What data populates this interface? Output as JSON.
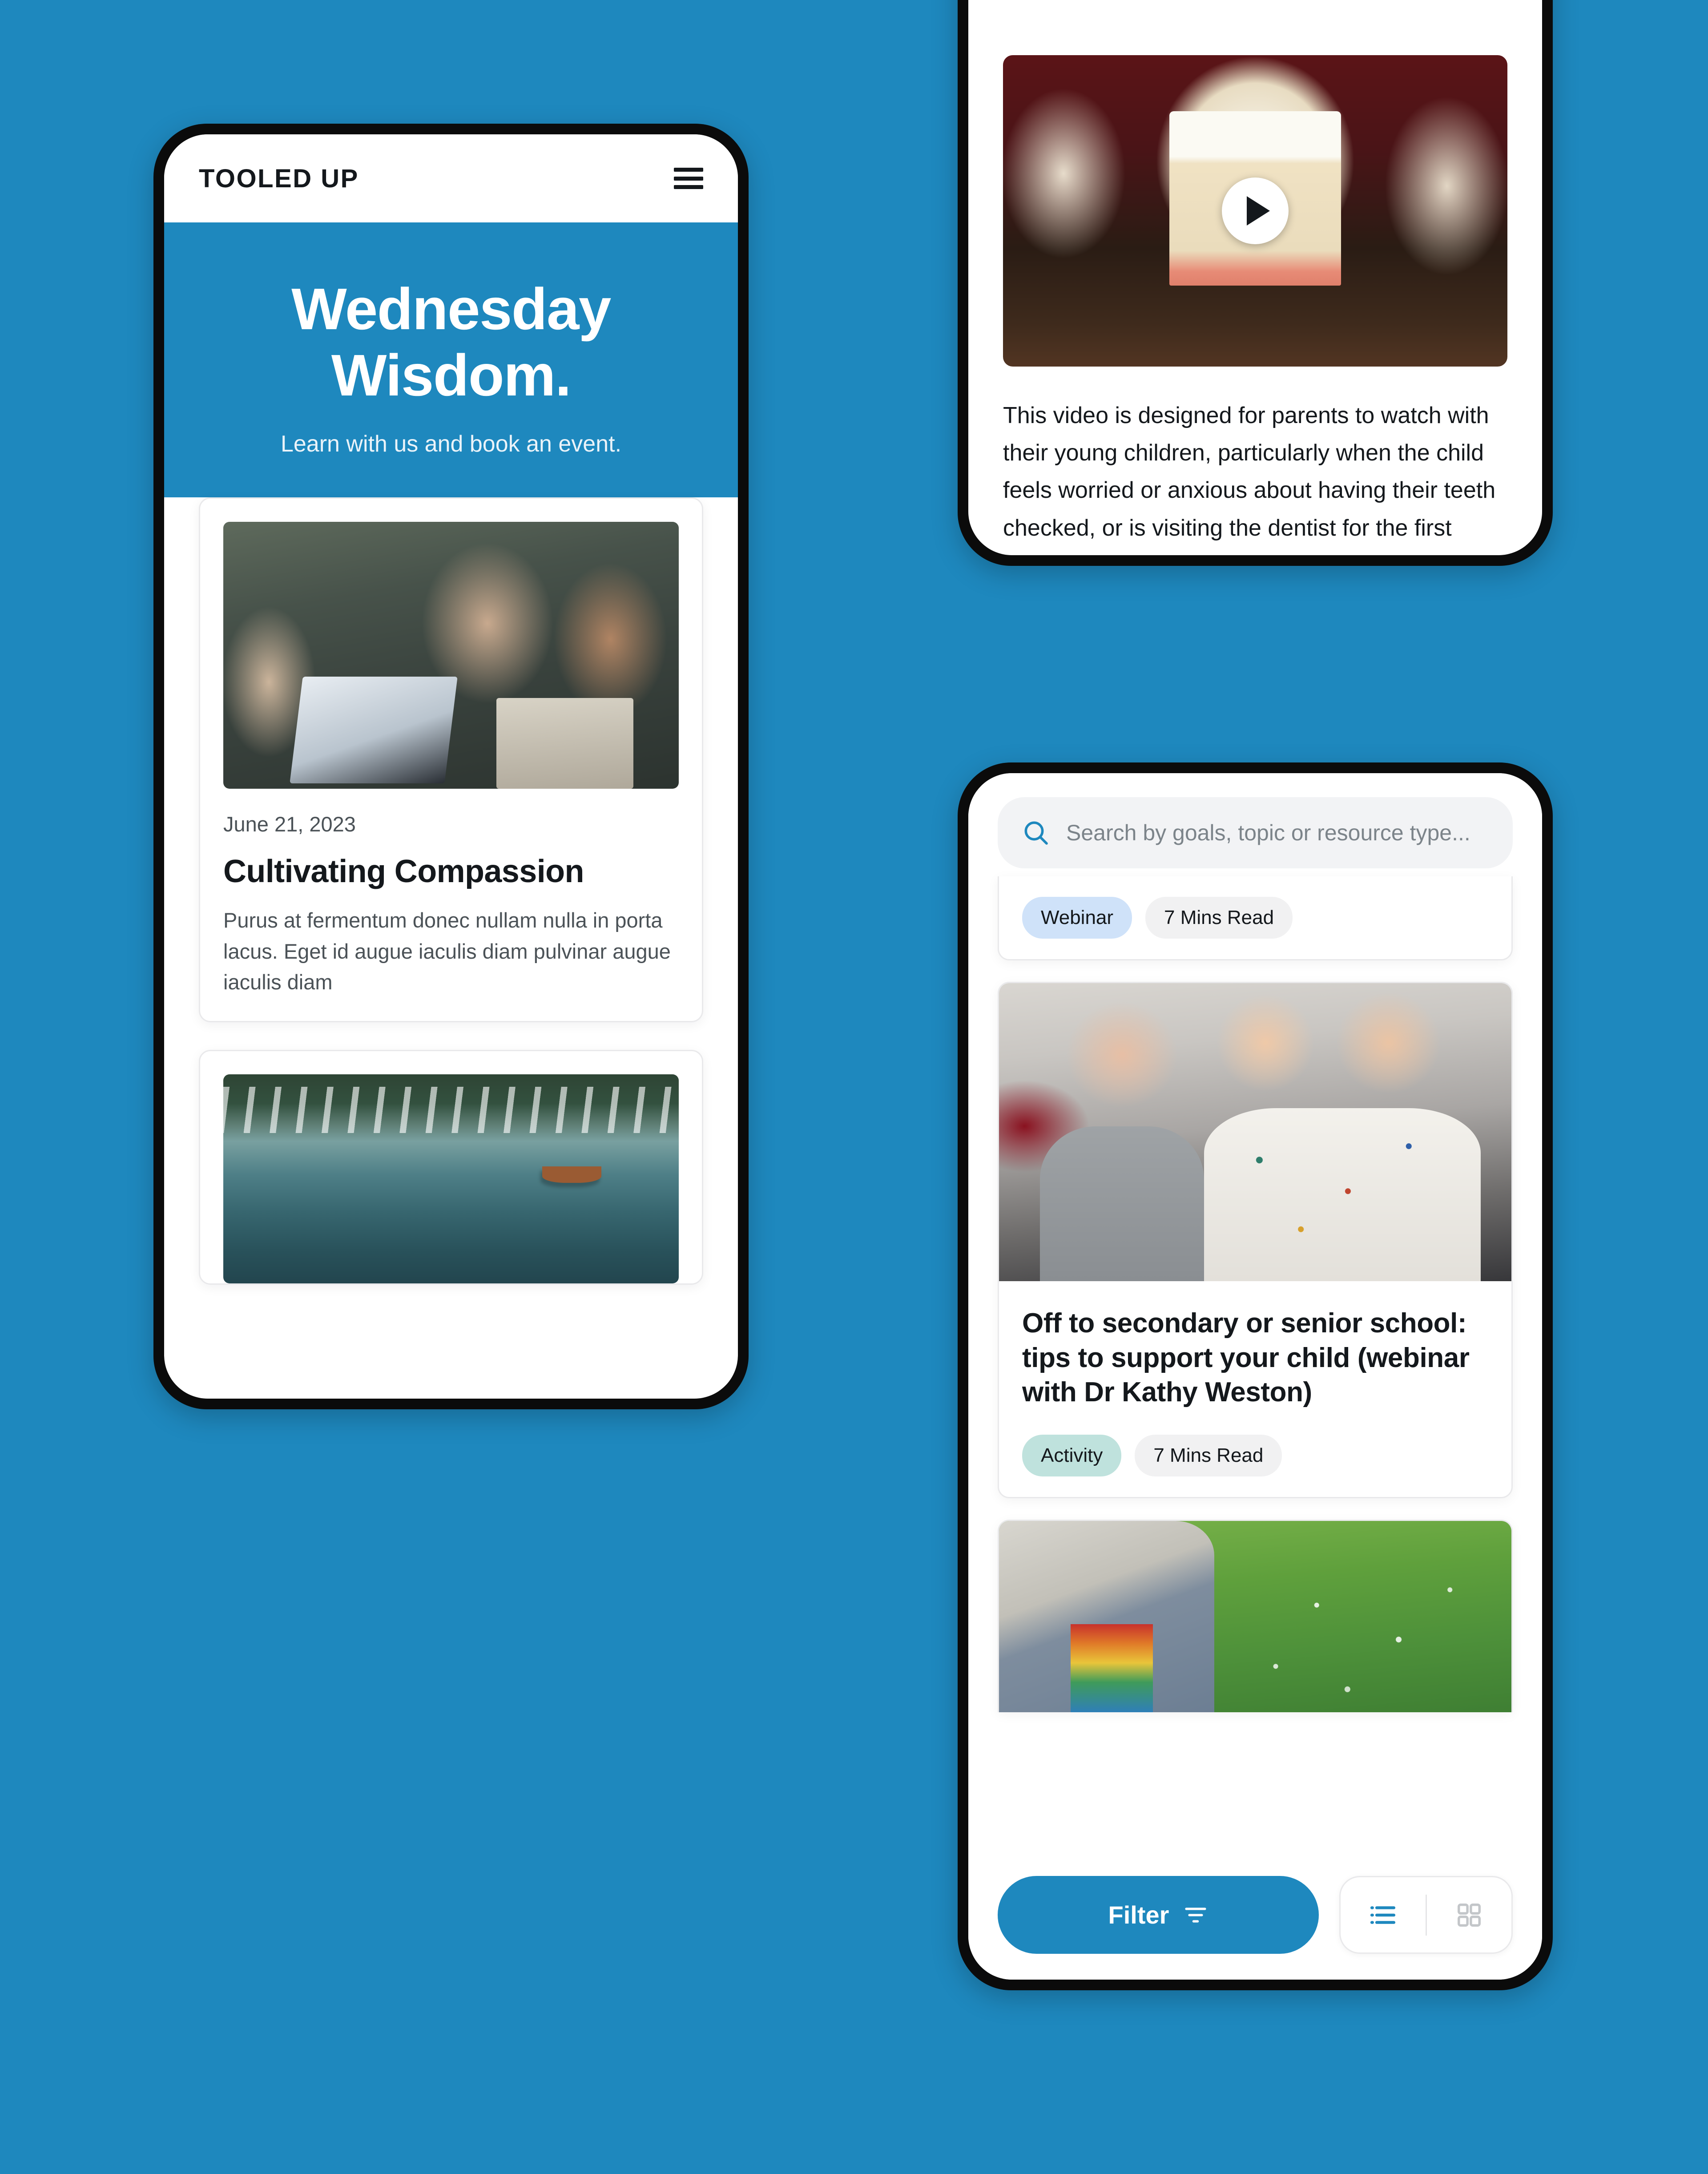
{
  "background_color": "#1E88BE",
  "accent_color": "#1E88BE",
  "phone_wisdom": {
    "header": {
      "brand": "TOOLED UP",
      "menu_icon": "hamburger-menu-icon"
    },
    "hero": {
      "title_line1": "Wednesday",
      "title_line2": "Wisdom.",
      "subtitle": "Learn with us and book an event."
    },
    "articles": [
      {
        "image": "three-people-laughing-at-laptop-photo",
        "date": "June 21, 2023",
        "title": "Cultivating Compassion",
        "excerpt": "Purus at fermentum donec nullam nulla in porta lacus. Eget id augue iaculis diam pulvinar augue iaculis diam"
      },
      {
        "image": "mountain-lake-rowing-boat-photo"
      }
    ]
  },
  "phone_video": {
    "video": {
      "thumbnail": "dental-teeth-models-on-table-photo",
      "play_icon": "play-button-icon"
    },
    "description": "This video is designed for parents to watch with their young children, particularly when the child feels worried or anxious about having their teeth checked, or is visiting the dentist for the first time. It takes children through an"
  },
  "phone_resources": {
    "search": {
      "icon": "search-icon",
      "placeholder": "Search by goals, topic or resource type...",
      "value": ""
    },
    "results": [
      {
        "partial": "top",
        "chips": [
          {
            "label": "Webinar",
            "style": "webinar"
          },
          {
            "label": "7 Mins Read",
            "style": "neutral"
          }
        ]
      },
      {
        "image": "three-laughing-children-hugging-photo",
        "title": "Off to secondary or senior school: tips to support your child (webinar with Dr Kathy Weston)",
        "chips": [
          {
            "label": "Activity",
            "style": "activity"
          },
          {
            "label": "7 Mins Read",
            "style": "neutral"
          }
        ]
      },
      {
        "partial": "bottom",
        "image": "child-in-daisy-meadow-photo"
      }
    ],
    "bottom_bar": {
      "filter_label": "Filter",
      "filter_icon": "funnel-filter-icon",
      "view_list_icon": "list-view-icon",
      "view_grid_icon": "grid-view-icon",
      "active_view": "list"
    }
  }
}
